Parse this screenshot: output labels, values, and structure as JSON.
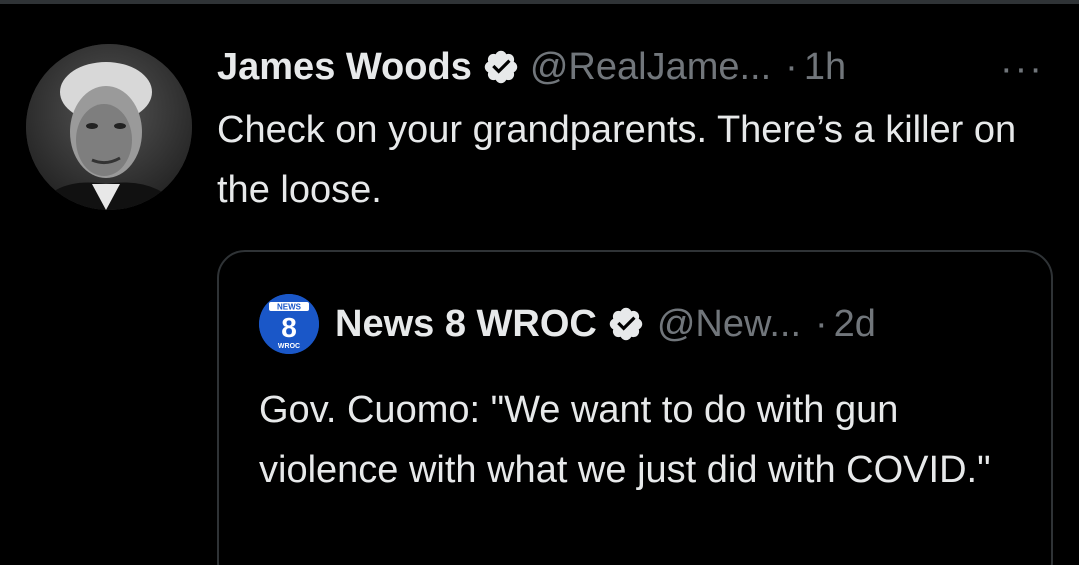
{
  "tweet": {
    "author_name": "James Woods",
    "handle": "@RealJame...",
    "separator": "·",
    "time": "1h",
    "more_label": "···",
    "text": "Check on your grandparents. There’s a killer on the loose.",
    "avatar_icon": "person-photo-icon",
    "verified_icon": "verified-badge-icon"
  },
  "quoted": {
    "author_name": "News 8 WROC",
    "handle": "@New...",
    "separator": "·",
    "time": "2d",
    "text": "Gov. Cuomo: \"We want to do with gun violence with what we just did with COVID.\"",
    "logo_top": "NEWS",
    "logo_number": "8",
    "logo_bottom": "WROC",
    "logo_color": "#1a57c8"
  },
  "colors": {
    "background": "#000000",
    "text_primary": "#e7e9ea",
    "text_secondary": "#71767b",
    "border": "#2f3336"
  }
}
